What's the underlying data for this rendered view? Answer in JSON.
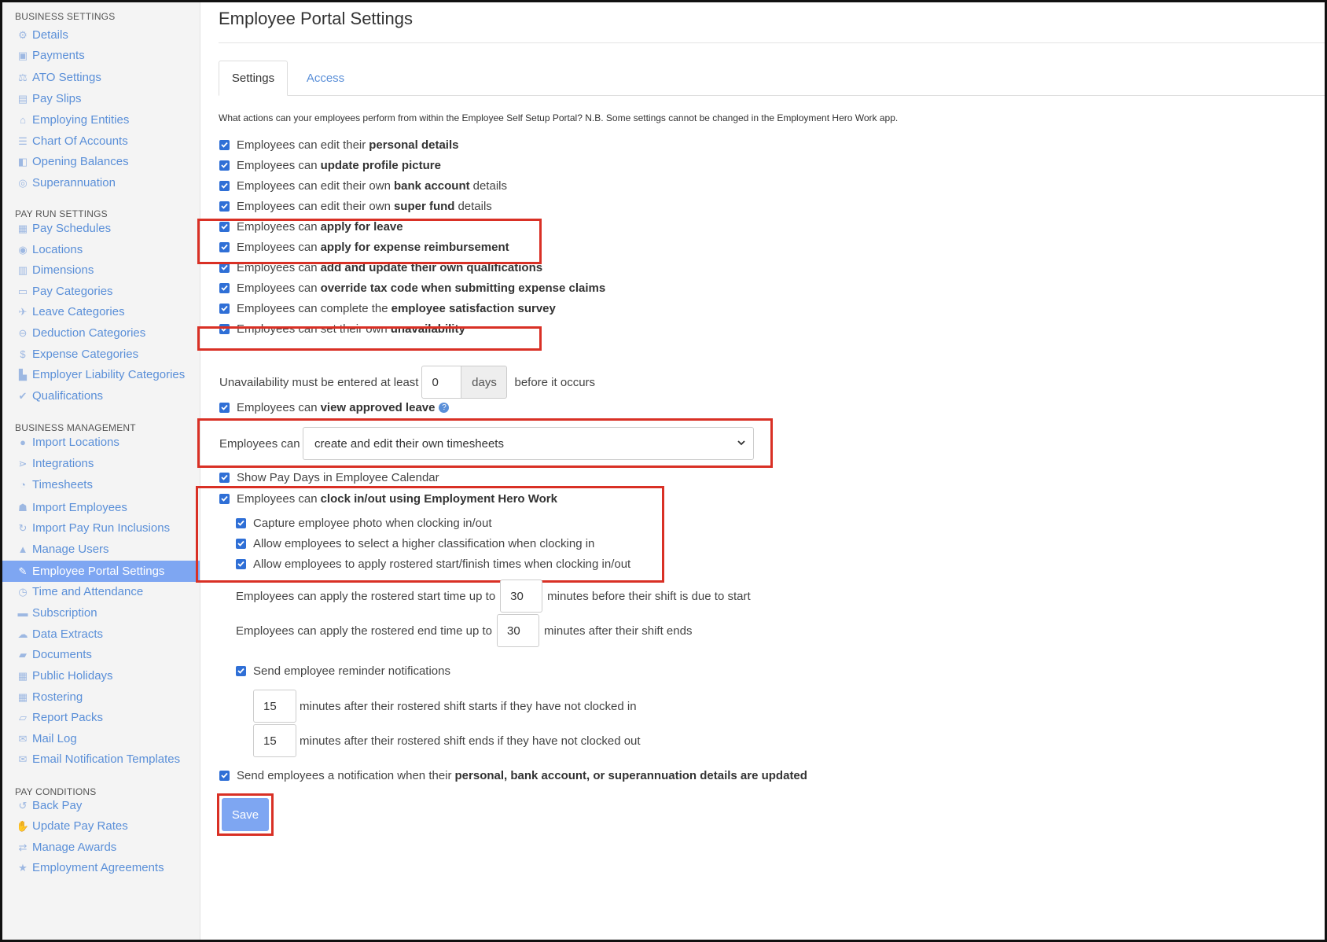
{
  "sidebar": {
    "sections": [
      {
        "heading": "BUSINESS SETTINGS",
        "items": [
          {
            "label": "Details",
            "icon": "gear-icon"
          },
          {
            "label": "Payments",
            "icon": "save-icon"
          },
          {
            "label": "ATO Settings",
            "icon": "balance-scale-icon"
          },
          {
            "label": "Pay Slips",
            "icon": "file-icon"
          },
          {
            "label": "Employing Entities",
            "icon": "bank-icon"
          },
          {
            "label": "Chart Of Accounts",
            "icon": "list-icon"
          },
          {
            "label": "Opening Balances",
            "icon": "ledger-icon"
          },
          {
            "label": "Superannuation",
            "icon": "lifebuoy-icon"
          }
        ]
      },
      {
        "heading": "PAY RUN SETTINGS",
        "items": [
          {
            "label": "Pay Schedules",
            "icon": "calendar-icon"
          },
          {
            "label": "Locations",
            "icon": "globe-icon"
          },
          {
            "label": "Dimensions",
            "icon": "bar-chart-icon"
          },
          {
            "label": "Pay Categories",
            "icon": "money-icon"
          },
          {
            "label": "Leave Categories",
            "icon": "plane-icon"
          },
          {
            "label": "Deduction Categories",
            "icon": "minus-circle-icon"
          },
          {
            "label": "Expense Categories",
            "icon": "dollar-circle-icon"
          },
          {
            "label": "Employer Liability Categories",
            "icon": "factory-icon"
          },
          {
            "label": "Qualifications",
            "icon": "check-icon"
          }
        ]
      },
      {
        "heading": "BUSINESS MANAGEMENT",
        "items": [
          {
            "label": "Import Locations",
            "icon": "map-marker-icon"
          },
          {
            "label": "Integrations",
            "icon": "share-icon"
          },
          {
            "label": "Timesheets",
            "icon": "clock-icon"
          },
          {
            "label": "Import Employees",
            "icon": "users-icon"
          },
          {
            "label": "Import Pay Run Inclusions",
            "icon": "refresh-icon"
          },
          {
            "label": "Manage Users",
            "icon": "lock-icon"
          },
          {
            "label": "Employee Portal Settings",
            "icon": "magic-wand-icon",
            "active": true
          },
          {
            "label": "Time and Attendance",
            "icon": "stopwatch-icon"
          },
          {
            "label": "Subscription",
            "icon": "credit-card-icon"
          },
          {
            "label": "Data Extracts",
            "icon": "cloud-download-icon"
          },
          {
            "label": "Documents",
            "icon": "folder-icon"
          },
          {
            "label": "Public Holidays",
            "icon": "calendar-icon"
          },
          {
            "label": "Rostering",
            "icon": "calendar-check-icon"
          },
          {
            "label": "Report Packs",
            "icon": "folder-open-icon"
          },
          {
            "label": "Mail Log",
            "icon": "envelope-icon"
          },
          {
            "label": "Email Notification Templates",
            "icon": "envelope-open-icon"
          }
        ]
      },
      {
        "heading": "PAY CONDITIONS",
        "items": [
          {
            "label": "Back Pay",
            "icon": "history-icon"
          },
          {
            "label": "Update Pay Rates",
            "icon": "hand-money-icon"
          },
          {
            "label": "Manage Awards",
            "icon": "exchange-icon"
          },
          {
            "label": "Employment Agreements",
            "icon": "star-icon"
          }
        ]
      }
    ]
  },
  "main": {
    "title": "Employee Portal Settings",
    "tabs": [
      {
        "label": "Settings",
        "active": true
      },
      {
        "label": "Access",
        "active": false
      }
    ],
    "description": "What actions can your employees perform from within the Employee Self Setup Portal? N.B. Some settings cannot be changed in the Employment Hero Work app.",
    "checks": [
      {
        "prefix": "Employees can edit their",
        "bold": "personal details",
        "suffix": "",
        "checked": true
      },
      {
        "prefix": "Employees can",
        "bold": "update profile picture",
        "suffix": "",
        "checked": true
      },
      {
        "prefix": "Employees can edit their own",
        "bold": "bank account",
        "suffix": "details",
        "checked": true
      },
      {
        "prefix": "Employees can edit their own",
        "bold": "super fund",
        "suffix": "details",
        "checked": true
      },
      {
        "prefix": "Employees can",
        "bold": "apply for leave",
        "suffix": "",
        "checked": true
      },
      {
        "prefix": "Employees can",
        "bold": "apply for expense reimbursement",
        "suffix": "",
        "checked": true
      },
      {
        "prefix": "Employees can",
        "bold": "add and update their own qualifications",
        "suffix": "",
        "checked": true
      },
      {
        "prefix": "Employees can",
        "bold": "override tax code when submitting expense claims",
        "suffix": "",
        "checked": true
      },
      {
        "prefix": "Employees can complete the",
        "bold": "employee satisfaction survey",
        "suffix": "",
        "checked": true
      },
      {
        "prefix": "Employees can set their own",
        "bold": "unavailability",
        "suffix": "",
        "checked": true
      }
    ],
    "unavailability": {
      "before": "Unavailability must be entered at least",
      "value": "0",
      "unit": "days",
      "after": "before it occurs"
    },
    "view_leave": {
      "prefix": "Employees can",
      "bold": "view approved leave",
      "checked": true
    },
    "timesheet": {
      "label": "Employees can",
      "selected": "create and edit their own timesheets"
    },
    "pay_days": {
      "label": "Show Pay Days in Employee Calendar",
      "checked": true
    },
    "clock": {
      "prefix": "Employees can",
      "bold": "clock in/out using Employment Hero Work",
      "checked": true
    },
    "clock_sub": [
      {
        "label": "Capture employee photo when clocking in/out",
        "checked": true
      },
      {
        "label": "Allow employees to select a higher classification when clocking in",
        "checked": true
      },
      {
        "label": "Allow employees to apply rostered start/finish times when clocking in/out",
        "checked": true
      }
    ],
    "rostered_start": {
      "before": "Employees can apply the rostered start time up to",
      "value": "30",
      "after": "minutes before their shift is due to start"
    },
    "rostered_end": {
      "before": "Employees can apply the rostered end time up to",
      "value": "30",
      "after": "minutes after their shift ends"
    },
    "reminders": {
      "label": "Send employee reminder notifications",
      "checked": true
    },
    "reminder_start": {
      "value": "15",
      "after": "minutes after their rostered shift starts if they have not clocked in"
    },
    "reminder_end": {
      "value": "15",
      "after": "minutes after their rostered shift ends if they have not clocked out"
    },
    "notify": {
      "prefix": "Send employees a notification when their",
      "bold": "personal, bank account, or superannuation details are updated",
      "checked": true
    },
    "save_label": "Save"
  },
  "colors": {
    "accent": "#5a8fd8",
    "active_nav": "#7ea6f2",
    "checkbox": "#2f6fd6",
    "highlight": "#d93025"
  }
}
